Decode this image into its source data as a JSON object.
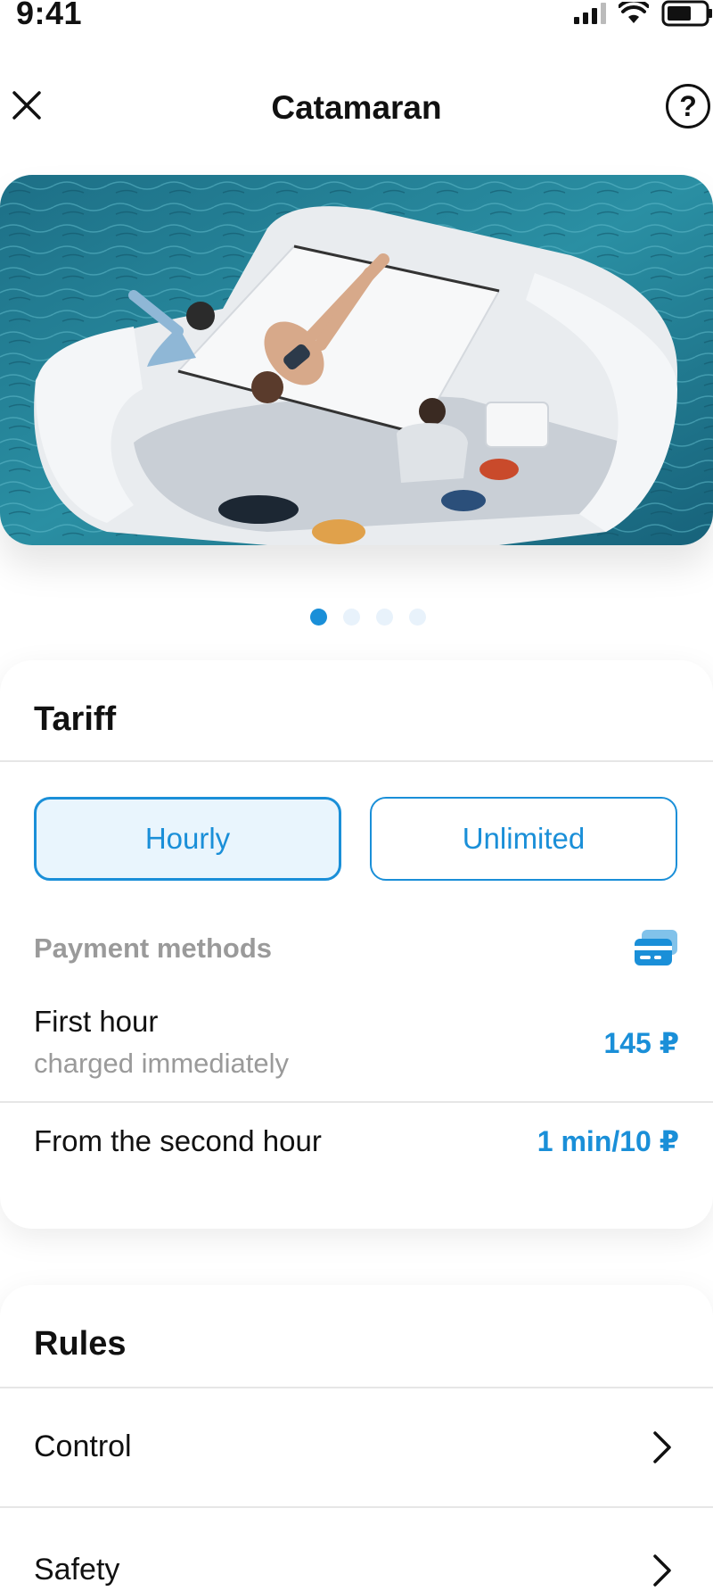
{
  "status_bar": {
    "time": "9:41",
    "icons": [
      "signal-icon",
      "wifi-icon",
      "battery-icon"
    ]
  },
  "nav": {
    "title": "Catamaran",
    "close_icon": "close-icon",
    "help_icon": "help-icon",
    "help_glyph": "?"
  },
  "carousel": {
    "slide_count": 4,
    "active_index": 0
  },
  "tariff": {
    "title": "Tariff",
    "options": [
      {
        "label": "Hourly",
        "selected": true
      },
      {
        "label": "Unlimited",
        "selected": false
      }
    ],
    "payment_methods_label": "Payment methods",
    "payment_icon": "credit-card-icon",
    "rows": [
      {
        "label": "First hour",
        "sublabel": "charged immediately",
        "price": "145 ₽"
      },
      {
        "label": "From the second hour",
        "price": "1 min/10 ₽"
      }
    ]
  },
  "rules": {
    "title": "Rules",
    "items": [
      {
        "label": "Control"
      },
      {
        "label": "Safety"
      }
    ]
  },
  "colors": {
    "accent": "#1a8fd8",
    "accent_bg": "#e9f5fd",
    "muted_text": "#9a9a9a",
    "divider": "#e6e6e6",
    "water": "#1f7f93"
  }
}
